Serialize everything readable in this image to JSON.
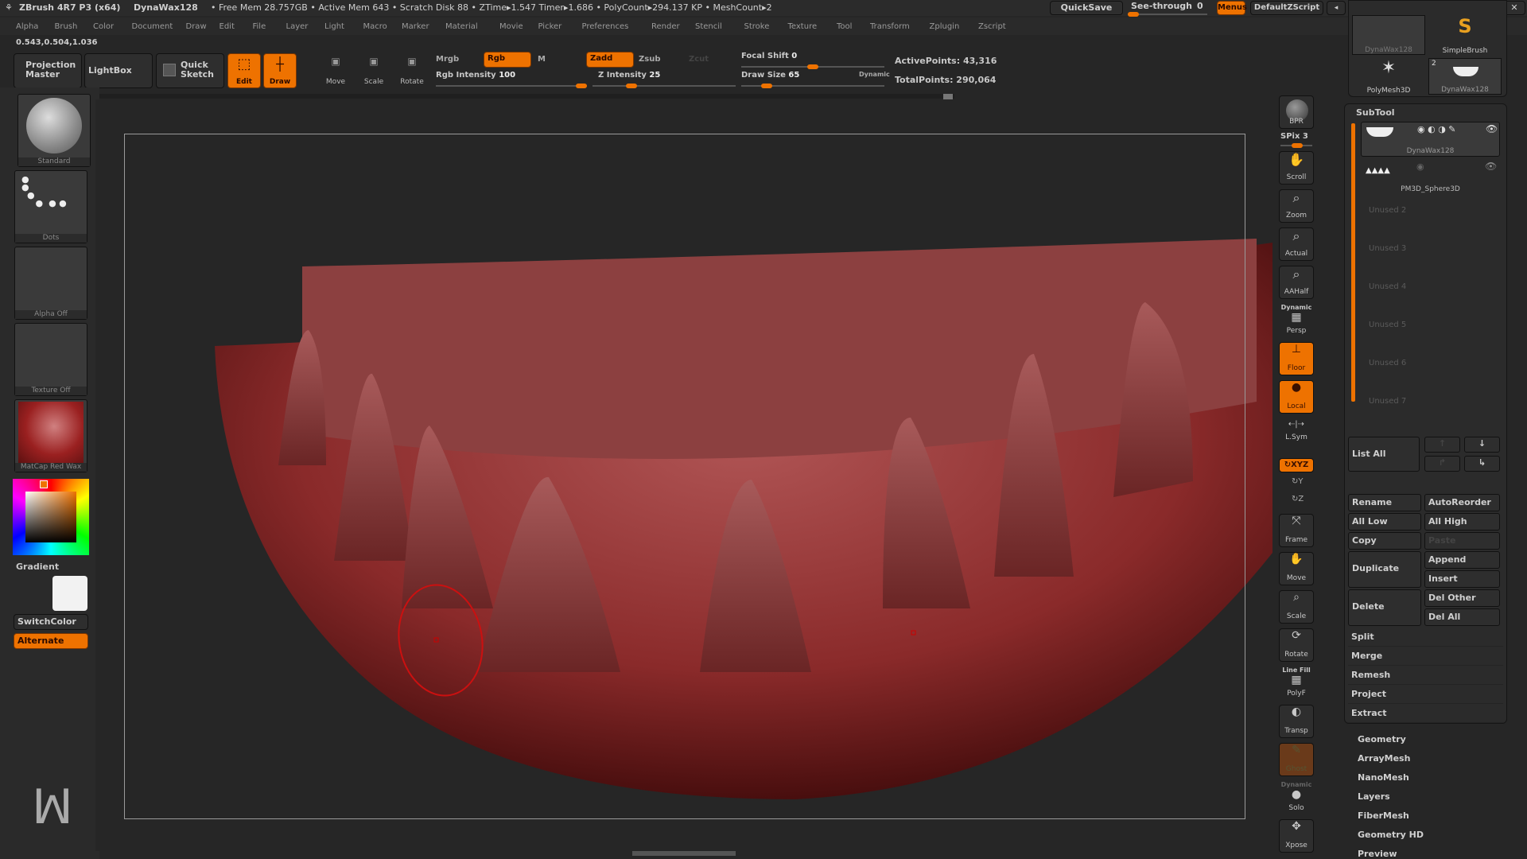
{
  "titlebar": {
    "app": "ZBrush 4R7 P3 (x64)",
    "tool": "DynaWax128",
    "stats": "• Free Mem 28.757GB • Active Mem 643 • Scratch Disk 88 • ZTime▸1.547 Timer▸1.686 • PolyCount▸294.137 KP • MeshCount▸2",
    "quicksave": "QuickSave",
    "seethrough_label": "See-through",
    "seethrough_value": "0",
    "seethrough_fraction": 0,
    "menus": "Menus",
    "script": "DefaultZScript"
  },
  "menubar": [
    "Alpha",
    "Brush",
    "Color",
    "Document",
    "Draw",
    "Edit",
    "File",
    "Layer",
    "Light",
    "Macro",
    "Marker",
    "Material",
    "Movie",
    "Picker",
    "Preferences",
    "Render",
    "Stencil",
    "Stroke",
    "Texture",
    "Tool",
    "Transform",
    "Zplugin",
    "Zscript"
  ],
  "coords": "0.543,0.504,1.036",
  "toolbar": {
    "projection_master": "Projection Master",
    "lightbox": "LightBox",
    "quick_sketch": "Quick Sketch",
    "edit": "Edit",
    "draw": "Draw",
    "move": "Move",
    "scale": "Scale",
    "rotate": "Rotate",
    "mrgb": "Mrgb",
    "rgb": "Rgb",
    "m": "M",
    "zadd": "Zadd",
    "zsub": "Zsub",
    "zcut": "Zcut",
    "rgb_intensity_label": "Rgb Intensity",
    "rgb_intensity": "100",
    "z_intensity_label": "Z Intensity",
    "z_intensity": "25",
    "focal_shift_label": "Focal Shift",
    "focal_shift": "0",
    "draw_size_label": "Draw Size",
    "draw_size": "65",
    "dynamic": "Dynamic",
    "active_points": "ActivePoints: 43,316",
    "total_points": "TotalPoints: 290,064"
  },
  "lefttray": {
    "brush": "Standard",
    "stroke": "Dots",
    "alpha": "Alpha Off",
    "texture": "Texture Off",
    "material": "MatCap Red Wax",
    "gradient": "Gradient",
    "switchcolor": "SwitchColor",
    "alternate": "Alternate"
  },
  "righttool": {
    "bpr": "BPR",
    "spix": "SPix 3",
    "scroll": "Scroll",
    "zoom": "Zoom",
    "actual": "Actual",
    "aahalf": "AAHalf",
    "dynamic": "Dynamic",
    "persp": "Persp",
    "floor": "Floor",
    "local": "Local",
    "lsym": "L.Sym",
    "xyz": "XYZ",
    "frame": "Frame",
    "move": "Move",
    "scale": "Scale",
    "rotate": "Rotate",
    "linefill": "Line Fill",
    "polyf": "PolyF",
    "transp": "Transp",
    "ghost": "Ghost",
    "dynamic2": "Dynamic",
    "solo": "Solo",
    "xpose": "Xpose"
  },
  "toolthumbs": [
    {
      "label": "DynaWax128"
    },
    {
      "label": "SimpleBrush"
    },
    {
      "label": "PolyMesh3D"
    },
    {
      "label": "DynaWax128",
      "badge": "2"
    }
  ],
  "subtool": {
    "title": "SubTool",
    "items": [
      "DynaWax128",
      "PM3D_Sphere3D"
    ],
    "unused": [
      "Unused 2",
      "Unused 3",
      "Unused 4",
      "Unused 5",
      "Unused 6",
      "Unused 7"
    ],
    "list_all": "List All",
    "rename": "Rename",
    "autoreorder": "AutoReorder",
    "all_low": "All Low",
    "all_high": "All High",
    "copy": "Copy",
    "paste": "Paste",
    "duplicate": "Duplicate",
    "append": "Append",
    "insert": "Insert",
    "delete": "Delete",
    "del_other": "Del Other",
    "del_all": "Del All",
    "rows": [
      "Split",
      "Merge",
      "Remesh",
      "Project",
      "Extract"
    ]
  },
  "toolsections": [
    "Geometry",
    "ArrayMesh",
    "NanoMesh",
    "Layers",
    "FiberMesh",
    "Geometry HD",
    "Preview"
  ],
  "colors": {
    "accent": "#ee7200",
    "model": "#8a2a2a"
  }
}
